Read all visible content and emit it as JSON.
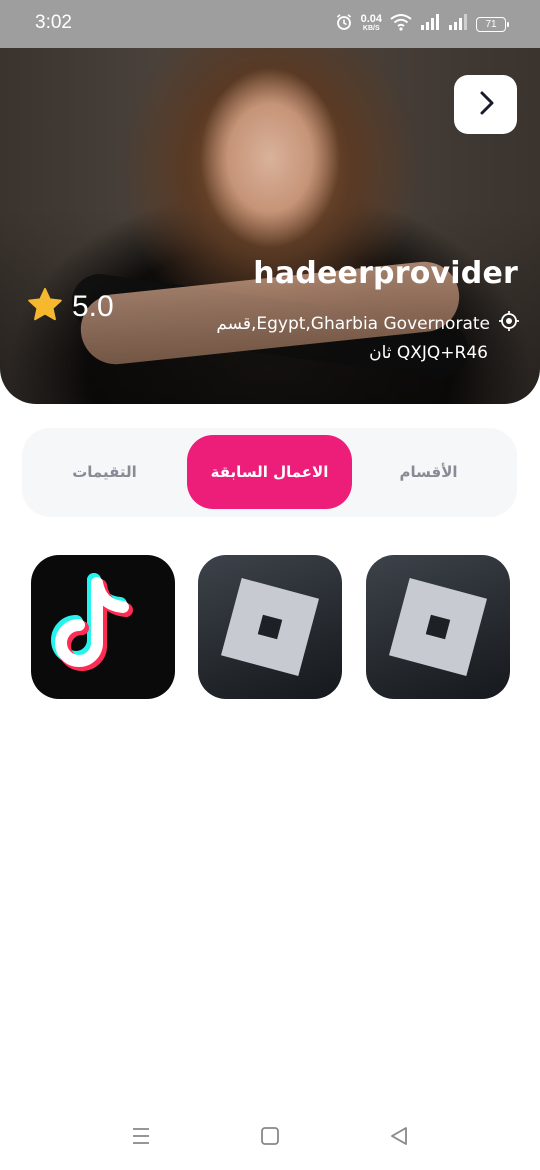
{
  "status": {
    "time": "3:02",
    "net_speed_value": "0.04",
    "net_speed_unit": "KB/S",
    "battery": "71",
    "icons": [
      "alarm-icon",
      "wifi-icon",
      "signal-icon",
      "signal-icon",
      "battery-icon"
    ]
  },
  "profile": {
    "name": "hadeerprovider",
    "location_line1": "قسم,Egypt,Gharbia Governorate",
    "location_line2": "ثان QXJQ+R46",
    "rating": "5.0"
  },
  "tabs": [
    {
      "label": "الأقسام",
      "active": false
    },
    {
      "label": "الاعمال السابقة",
      "active": true
    },
    {
      "label": "التقيمات",
      "active": false
    }
  ],
  "gallery": [
    {
      "icon": "roblox-icon"
    },
    {
      "icon": "roblox-icon"
    },
    {
      "icon": "tiktok-icon"
    }
  ],
  "colors": {
    "accent": "#ec1e79",
    "tabs_bg": "#f6f7f9",
    "star": "#f5b82e"
  }
}
